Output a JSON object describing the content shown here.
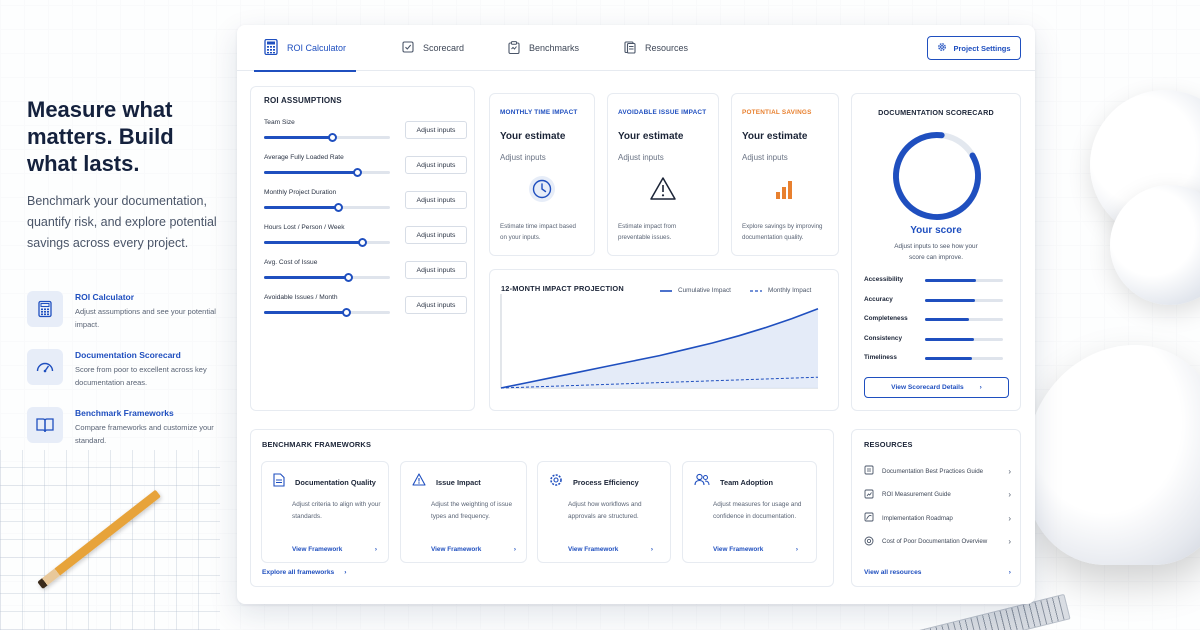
{
  "hero": {
    "headline": "Measure what matters. Build what lasts.",
    "subtext": "Benchmark your documentation, quantify risk, and explore potential savings across every project.",
    "features": [
      {
        "title": "ROI Calculator",
        "desc": "Adjust assumptions and see your potential impact.",
        "icon": "calculator-icon"
      },
      {
        "title": "Documentation Scorecard",
        "desc": "Score from poor to excellent across key documentation areas.",
        "icon": "gauge-icon"
      },
      {
        "title": "Benchmark Frameworks",
        "desc": "Compare frameworks and customize your standard.",
        "icon": "book-icon"
      }
    ]
  },
  "tabs": [
    {
      "label": "ROI Calculator",
      "icon": "calculator-icon",
      "active": true
    },
    {
      "label": "Scorecard",
      "icon": "checkbox-icon"
    },
    {
      "label": "Benchmarks",
      "icon": "clipboard-icon"
    },
    {
      "label": "Resources",
      "icon": "document-icon"
    }
  ],
  "project_settings_label": "Project Settings",
  "assumptions": {
    "title": "ROI ASSUMPTIONS",
    "button_label": "Adjust inputs",
    "rows": [
      {
        "label": "Team Size",
        "level": 0.54
      },
      {
        "label": "Average Fully Loaded Rate",
        "level": 0.74
      },
      {
        "label": "Monthly Project Duration",
        "level": 0.59
      },
      {
        "label": "Hours Lost / Person / Week",
        "level": 0.78
      },
      {
        "label": "Avg. Cost of Issue",
        "level": 0.67
      },
      {
        "label": "Avoidable Issues / Month",
        "level": 0.65
      }
    ]
  },
  "metrics": [
    {
      "title": "MONTHLY TIME IMPACT",
      "estimate": "Your estimate",
      "adjust": "Adjust inputs",
      "desc": "Estimate time impact based on your inputs.",
      "icon": "clock-icon",
      "color": "#1f4fbf"
    },
    {
      "title": "AVOIDABLE ISSUE IMPACT",
      "estimate": "Your estimate",
      "adjust": "Adjust inputs",
      "desc": "Estimate impact from preventable issues.",
      "icon": "warning-icon",
      "color": "#1f4fbf"
    },
    {
      "title": "POTENTIAL SAVINGS",
      "estimate": "Your estimate",
      "adjust": "Adjust inputs",
      "desc": "Explore savings by improving documentation quality.",
      "icon": "bar-chart-icon",
      "color": "#e8802f"
    }
  ],
  "projection": {
    "title": "12-MONTH IMPACT PROJECTION",
    "legend_cumulative": "Cumulative Impact",
    "legend_monthly": "Monthly Impact"
  },
  "chart_data": {
    "type": "area",
    "title": "12-MONTH IMPACT PROJECTION",
    "x": [
      0,
      1,
      2,
      3,
      4,
      5,
      6,
      7,
      8,
      9,
      10,
      11,
      12
    ],
    "series": [
      {
        "name": "Cumulative Impact",
        "values": [
          0,
          6,
          12,
          18,
          24,
          30,
          36,
          43,
          50,
          58,
          67,
          77,
          88
        ]
      },
      {
        "name": "Monthly Impact",
        "values": [
          0,
          1,
          2,
          3,
          4,
          5,
          6,
          7,
          8,
          9,
          10,
          11,
          12
        ]
      }
    ],
    "ylim": [
      0,
      100
    ],
    "xlim": [
      0,
      12
    ],
    "grid": false,
    "legend": "top-right"
  },
  "scorecard": {
    "title": "DOCUMENTATION SCORECARD",
    "score_label": "Your score",
    "score_desc": "Adjust inputs to see how your score can improve.",
    "ring_level": 0.85,
    "rows": [
      {
        "label": "Accessibility",
        "level": 0.65
      },
      {
        "label": "Accuracy",
        "level": 0.64
      },
      {
        "label": "Completeness",
        "level": 0.57
      },
      {
        "label": "Consistency",
        "level": 0.63
      },
      {
        "label": "Timeliness",
        "level": 0.6
      }
    ],
    "details_button": "View Scorecard Details"
  },
  "benchmarks": {
    "title": "BENCHMARK FRAMEWORKS",
    "cards": [
      {
        "title": "Documentation Quality",
        "desc": "Adjust criteria to align with your standards.",
        "link": "View Framework",
        "icon": "document-icon"
      },
      {
        "title": "Issue Impact",
        "desc": "Adjust the weighting of issue types and frequency.",
        "link": "View Framework",
        "icon": "warning-icon"
      },
      {
        "title": "Process Efficiency",
        "desc": "Adjust how workflows and approvals are structured.",
        "link": "View Framework",
        "icon": "gear-icon"
      },
      {
        "title": "Team Adoption",
        "desc": "Adjust measures for usage and confidence in documentation.",
        "link": "View Framework",
        "icon": "users-icon"
      }
    ],
    "explore_link": "Explore all frameworks"
  },
  "resources": {
    "title": "RESOURCES",
    "items": [
      {
        "label": "Documentation Best Practices Guide",
        "icon": "book-icon"
      },
      {
        "label": "ROI Measurement Guide",
        "icon": "chart-doc-icon"
      },
      {
        "label": "Implementation Roadmap",
        "icon": "map-icon"
      },
      {
        "label": "Cost of Poor Documentation Overview",
        "icon": "target-icon"
      }
    ],
    "view_all": "View all resources"
  },
  "colors": {
    "accent": "#1f4fbf",
    "orange": "#e8802f",
    "track": "#dfe4ec"
  }
}
